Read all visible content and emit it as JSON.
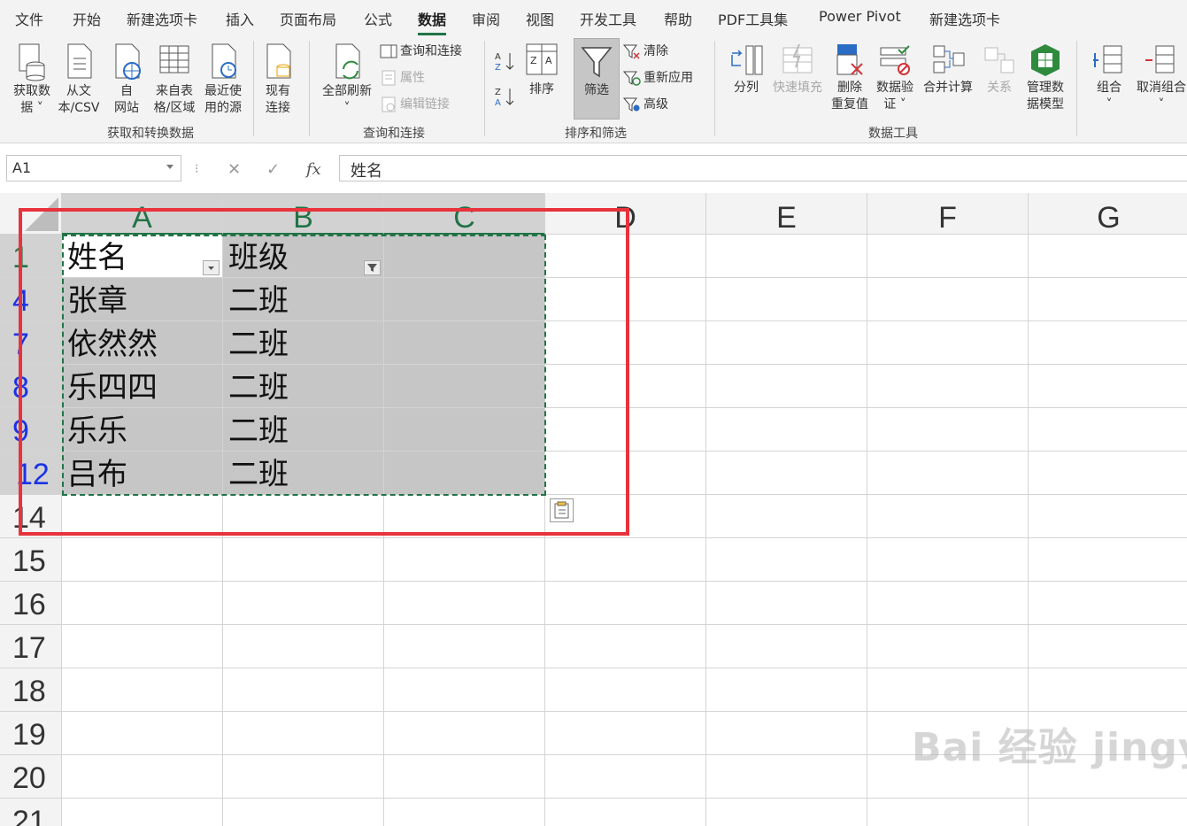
{
  "tabs": [
    "文件",
    "开始",
    "新建选项卡",
    "插入",
    "页面布局",
    "公式",
    "数据",
    "审阅",
    "视图",
    "开发工具",
    "帮助",
    "PDF工具集",
    "Power Pivot",
    "新建选项卡"
  ],
  "active_tab": "数据",
  "ribbon": {
    "get_data": [
      "获取数",
      "据 ˅"
    ],
    "from_text": [
      "从文",
      "本/CSV"
    ],
    "from_web": [
      "自",
      "网站"
    ],
    "from_table": [
      "来自表",
      "格/区域"
    ],
    "recent_sources": [
      "最近使",
      "用的源"
    ],
    "existing_conn": [
      "现有",
      "连接"
    ],
    "group_get_transform": "获取和转换数据",
    "refresh_all": [
      "全部刷新",
      "˅"
    ],
    "queries_conn": "查询和连接",
    "properties": "属性",
    "edit_links": "编辑链接",
    "group_queries": "查询和连接",
    "sort": "排序",
    "filter": "筛选",
    "clear": "清除",
    "reapply": "重新应用",
    "advanced": "高级",
    "group_sort_filter": "排序和筛选",
    "text_to_columns": "分列",
    "flash_fill": "快速填充",
    "remove_dup": [
      "删除",
      "重复值"
    ],
    "data_validation": [
      "数据验",
      "证 ˅"
    ],
    "consolidate": "合并计算",
    "relationships": "关系",
    "manage_model": [
      "管理数",
      "据模型"
    ],
    "group_data_tools": "数据工具",
    "group": [
      "组合",
      "˅"
    ],
    "ungroup": [
      "取消组合",
      "˅"
    ]
  },
  "formula_bar": {
    "name_box": "A1",
    "formula": "姓名"
  },
  "columns": [
    "A",
    "B",
    "C",
    "D",
    "E",
    "F",
    "G"
  ],
  "rows": [
    {
      "num": "1",
      "a": "姓名",
      "b": "班级"
    },
    {
      "num": "4",
      "a": "张章",
      "b": "二班"
    },
    {
      "num": "7",
      "a": "依然然",
      "b": "二班"
    },
    {
      "num": "8",
      "a": "乐四四",
      "b": "二班"
    },
    {
      "num": "9",
      "a": "乐乐",
      "b": "二班"
    },
    {
      "num": "12",
      "a": "吕布",
      "b": "二班"
    },
    {
      "num": "14",
      "a": "",
      "b": ""
    },
    {
      "num": "15",
      "a": "",
      "b": ""
    },
    {
      "num": "16",
      "a": "",
      "b": ""
    },
    {
      "num": "17",
      "a": "",
      "b": ""
    },
    {
      "num": "18",
      "a": "",
      "b": ""
    },
    {
      "num": "19",
      "a": "",
      "b": ""
    },
    {
      "num": "20",
      "a": "",
      "b": ""
    },
    {
      "num": "21",
      "a": "",
      "b": ""
    }
  ],
  "watermark": "Bai 经验 jingyan.baidu.com"
}
